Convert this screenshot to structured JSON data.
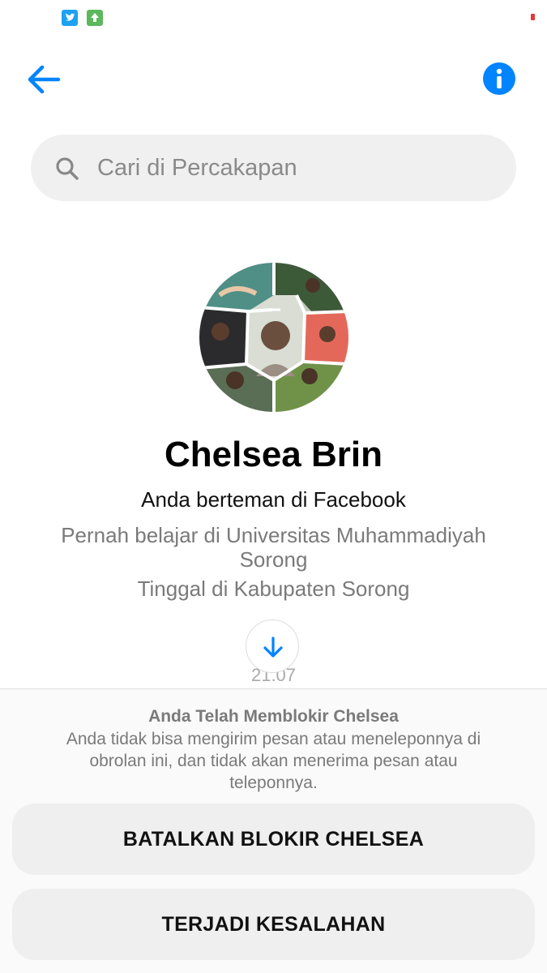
{
  "status_bar": {
    "icons": [
      "twitter-icon",
      "upload-icon"
    ]
  },
  "header": {
    "back_icon": "arrow-left-icon",
    "info_icon": "info-icon"
  },
  "search": {
    "placeholder": "Cari di Percakapan"
  },
  "profile": {
    "name": "Chelsea Brin",
    "friend_status": "Anda berteman di Facebook",
    "education": "Pernah belajar di Universitas Muhammadiyah Sorong",
    "residence": "Tinggal di Kabupaten Sorong"
  },
  "conversation": {
    "timestamp": "21.07"
  },
  "blocked_panel": {
    "title": "Anda Telah Memblokir Chelsea",
    "description": "Anda tidak bisa mengirim pesan atau meneleponnya di obrolan ini, dan tidak akan menerima pesan atau teleponnya.",
    "unblock_label": "BATALKAN BLOKIR CHELSEA",
    "error_label": "TERJADI KESALAHAN"
  },
  "colors": {
    "accent": "#0084ff",
    "text_secondary": "#7a7a7a",
    "button_bg": "#efefef"
  }
}
